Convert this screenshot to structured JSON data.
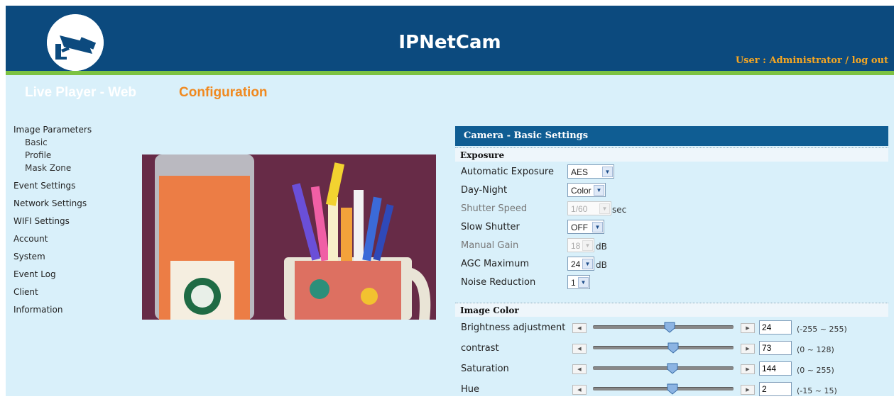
{
  "header": {
    "title": "IPNetCam",
    "user_text": "User : Administrator",
    "separator": "/",
    "logout": "log out"
  },
  "nav": {
    "tabs": [
      {
        "label": "Live Player - Web",
        "active": false
      },
      {
        "label": "Configuration",
        "active": true
      }
    ]
  },
  "sidebar": {
    "items": [
      {
        "label": "Image Parameters"
      },
      {
        "label": "Basic"
      },
      {
        "label": "Profile"
      },
      {
        "label": "Mask Zone"
      },
      {
        "label": "Event Settings"
      },
      {
        "label": "Network Settings"
      },
      {
        "label": "WIFI Settings"
      },
      {
        "label": "Account"
      },
      {
        "label": "System"
      },
      {
        "label": "Event Log"
      },
      {
        "label": "Client"
      },
      {
        "label": "Information"
      }
    ]
  },
  "panel": {
    "title": "Camera - Basic Settings",
    "exposure": {
      "heading": "Exposure",
      "rows": [
        {
          "label": "Automatic Exposure",
          "value": "AES",
          "unit": "",
          "enabled": true
        },
        {
          "label": "Day-Night",
          "value": "Color",
          "unit": "",
          "enabled": true
        },
        {
          "label": "Shutter Speed",
          "value": "1/60",
          "unit": "sec",
          "enabled": false
        },
        {
          "label": "Slow Shutter",
          "value": "OFF",
          "unit": "",
          "enabled": true
        },
        {
          "label": "Manual Gain",
          "value": "18",
          "unit": "dB",
          "enabled": false
        },
        {
          "label": "AGC Maximum",
          "value": "24",
          "unit": "dB",
          "enabled": true
        },
        {
          "label": "Noise Reduction",
          "value": "1",
          "unit": "",
          "enabled": true
        }
      ]
    },
    "image_color": {
      "heading": "Image Color",
      "sliders": [
        {
          "label": "Brightness adjustment",
          "value": "24",
          "range": "(-255 ~ 255)",
          "min": -255,
          "max": 255
        },
        {
          "label": "contrast",
          "value": "73",
          "range": "(0 ~ 128)",
          "min": 0,
          "max": 128
        },
        {
          "label": "Saturation",
          "value": "144",
          "range": "(0 ~ 255)",
          "min": 0,
          "max": 255
        },
        {
          "label": "Hue",
          "value": "2",
          "range": "(-15 ~ 15)",
          "min": -15,
          "max": 15
        }
      ]
    }
  },
  "colors": {
    "header_bg": "#0c4a7e",
    "accent_bar": "#7cc242",
    "nav_bg": "#d9f0fa",
    "active_tab": "#f0891f",
    "user_text": "#f5a623",
    "panel_head": "#0f5d93"
  },
  "icons": {
    "logo": "security-camera-icon",
    "dropdown": "chevron-down-icon",
    "step_left": "triangle-left-icon",
    "step_right": "triangle-right-icon"
  }
}
